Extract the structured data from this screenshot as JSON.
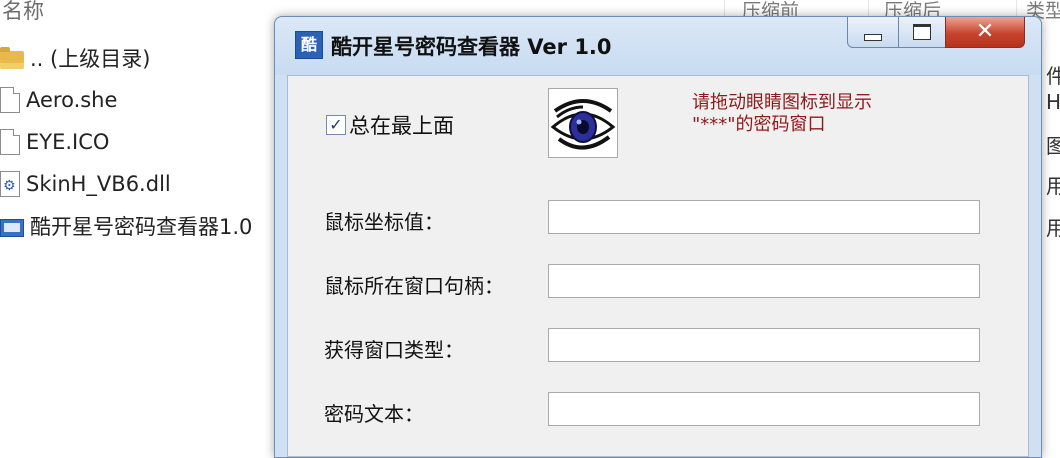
{
  "explorer": {
    "column_name": "名称",
    "columns": [
      "压缩前",
      "压缩后",
      "类型"
    ],
    "files": [
      {
        "name": ".. (上级目录)",
        "icon": "folder-icon"
      },
      {
        "name": "Aero.she",
        "icon": "file-icon"
      },
      {
        "name": "EYE.ICO",
        "icon": "file-icon"
      },
      {
        "name": "SkinH_VB6.dll",
        "icon": "dll-file-icon"
      },
      {
        "name": "酷开星号密码查看器1.0",
        "icon": "exe-file-icon"
      }
    ],
    "right_column_fragments": [
      "件",
      "H",
      "图",
      "用",
      "用"
    ]
  },
  "window": {
    "title": "酷开星号密码查看器   Ver 1.0",
    "app_icon_glyph": "酷",
    "always_on_top": {
      "label": "总在最上面",
      "checked": true
    },
    "hint": "请拖动眼睛图标到显示 \"***\"的密码窗口",
    "fields": [
      {
        "label": "鼠标坐标值：",
        "value": ""
      },
      {
        "label": "鼠标所在窗口句柄：",
        "value": ""
      },
      {
        "label": "获得窗口类型：",
        "value": ""
      },
      {
        "label": "密码文本：",
        "value": ""
      }
    ]
  }
}
